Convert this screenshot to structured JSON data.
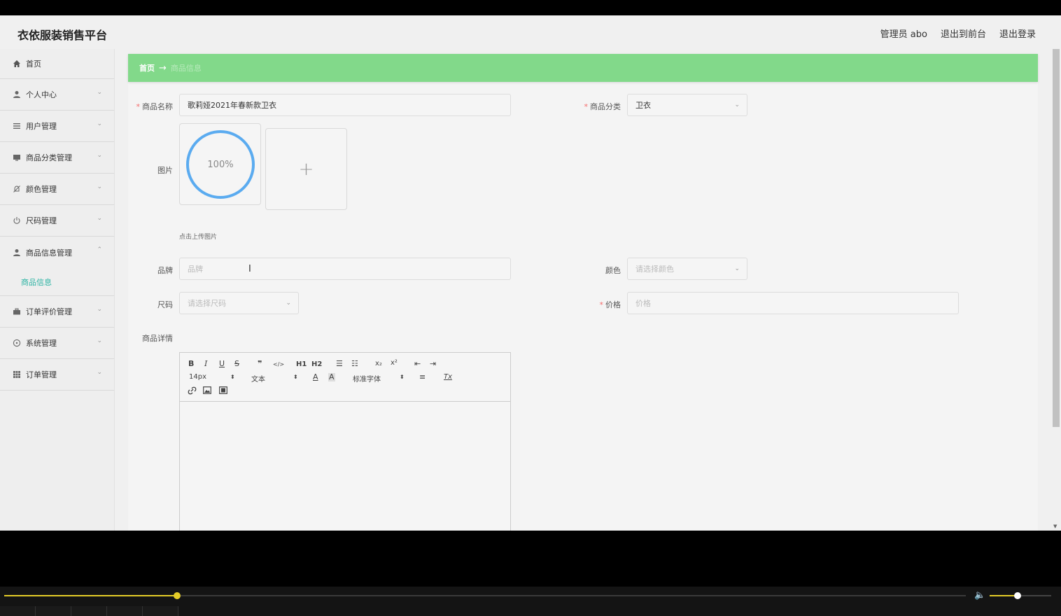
{
  "app": {
    "title": "衣依服装销售平台",
    "user_label": "管理员 abo",
    "to_frontend": "退出到前台",
    "logout": "退出登录"
  },
  "sidebar": {
    "items": [
      {
        "label": "首页",
        "icon": "home-icon",
        "expandable": false
      },
      {
        "label": "个人中心",
        "icon": "user-icon",
        "expandable": true
      },
      {
        "label": "用户管理",
        "icon": "list-icon",
        "expandable": true
      },
      {
        "label": "商品分类管理",
        "icon": "monitor-icon",
        "expandable": true
      },
      {
        "label": "颜色管理",
        "icon": "bell-off-icon",
        "expandable": true
      },
      {
        "label": "尺码管理",
        "icon": "power-icon",
        "expandable": true
      },
      {
        "label": "商品信息管理",
        "icon": "user-icon",
        "expandable": true,
        "expanded": true,
        "subitems": [
          "商品信息"
        ]
      },
      {
        "label": "订单评价管理",
        "icon": "briefcase-icon",
        "expandable": true
      },
      {
        "label": "系统管理",
        "icon": "compass-icon",
        "expandable": true
      },
      {
        "label": "订单管理",
        "icon": "grid-icon",
        "expandable": true
      }
    ],
    "chevron_down": "⌄",
    "chevron_up": "⌃"
  },
  "breadcrumb": {
    "home": "首页",
    "arrow": "→",
    "current": "商品信息"
  },
  "form": {
    "name_label": "商品名称",
    "name_value": "歌莉娅2021年春新款卫衣",
    "category_label": "商品分类",
    "category_value": "卫衣",
    "image_label": "图片",
    "upload_progress": "100%",
    "upload_progress_value": 100,
    "upload_plus": "+",
    "upload_hint": "点击上传图片",
    "brand_label": "品牌",
    "brand_placeholder": "品牌",
    "color_label": "颜色",
    "color_placeholder": "请选择颜色",
    "size_label": "尺码",
    "size_placeholder": "请选择尺码",
    "price_label": "价格",
    "price_placeholder": "价格",
    "detail_label": "商品详情",
    "required_mark": "*"
  },
  "editor": {
    "bold": "B",
    "italic": "I",
    "underline": "U",
    "strike": "S",
    "blockquote": "❞",
    "code": "</>",
    "h1": "H1",
    "h2": "H2",
    "ordered_list": "☰",
    "bullet_list": "☷",
    "subscript": "x₂",
    "superscript": "x²",
    "outdent": "⇤",
    "indent": "⇥",
    "font_size": "14px",
    "header_style": "文本",
    "font_color": "A",
    "bg_color": "A",
    "font_family": "标准字体",
    "align": "≡",
    "clean": "Tx",
    "link": "🔗",
    "image": "▣",
    "video": "▤"
  },
  "player": {
    "progress": 0.18,
    "volume": 0.45
  },
  "colors": {
    "accent": "#82d98a",
    "submenu_active": "#2bb3a3",
    "progress_ring": "#5aabf0",
    "player_accent": "#e4cc28"
  }
}
